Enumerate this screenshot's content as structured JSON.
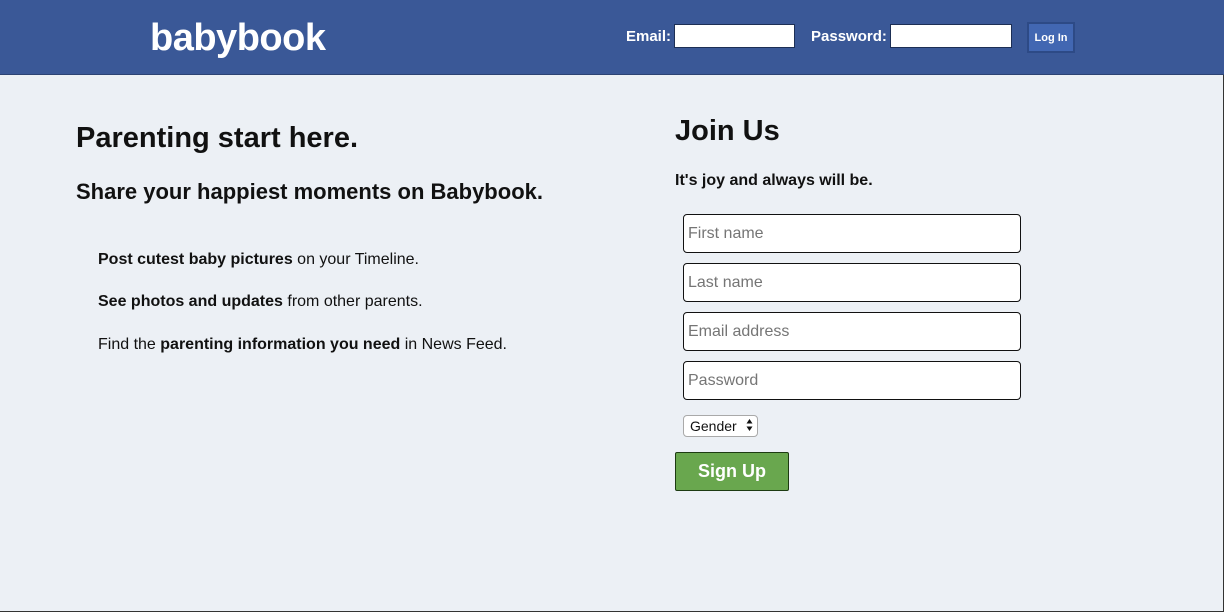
{
  "header": {
    "logo": "babybook",
    "email_label": "Email:",
    "email_value": "",
    "password_label": "Password:",
    "password_value": "",
    "login_label": "Log In"
  },
  "hero": {
    "title": "Parenting start here.",
    "subtitle": "Share your happiest moments on Babybook.",
    "features": [
      {
        "pre": "",
        "bold": "Post cutest baby pictures",
        "post": " on your Timeline."
      },
      {
        "pre": "",
        "bold": "See photos and updates",
        "post": " from other parents."
      },
      {
        "pre": "Find the ",
        "bold": "parenting information you need",
        "post": " in News Feed."
      }
    ]
  },
  "signup": {
    "title": "Join Us",
    "tagline": "It's joy and always will be.",
    "first_name_placeholder": "First name",
    "last_name_placeholder": "Last name",
    "email_placeholder": "Email address",
    "password_placeholder": "Password",
    "gender_selected": "Gender",
    "submit_label": "Sign Up"
  },
  "colors": {
    "header_bg": "#3a5897",
    "page_bg": "#ecf0f5",
    "signup_button": "#69a74e"
  },
  "icons": {
    "gender_select_arrows": "chevron-up-down-icon"
  }
}
